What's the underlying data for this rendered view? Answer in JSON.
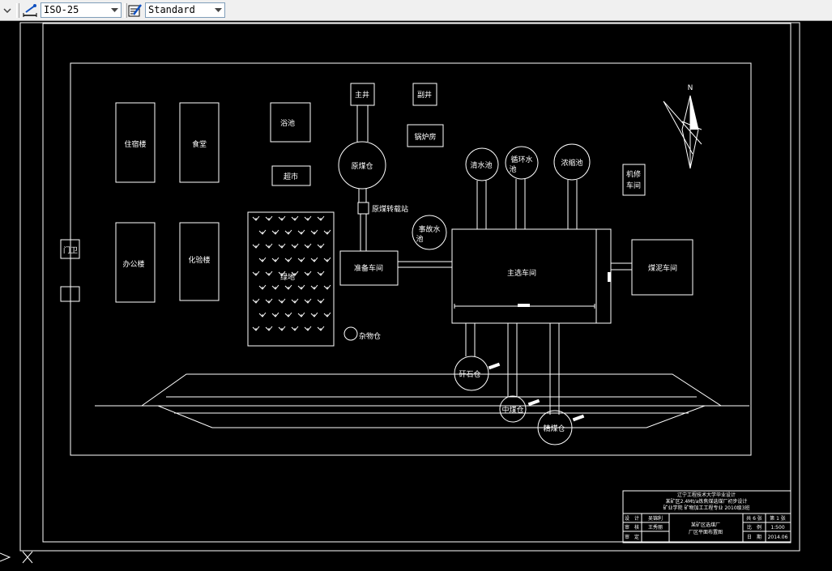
{
  "toolbar": {
    "dimstyle": "ISO-25",
    "textstyle": "Standard"
  },
  "labels": {
    "dorm": "住宿楼",
    "canteen": "食堂",
    "office": "办公楼",
    "lab": "化验楼",
    "gate": "门卫",
    "bath": "浴池",
    "market": "超市",
    "main_shaft": "主井",
    "aux_shaft": "副井",
    "boiler": "锅炉房",
    "raw_silo": "原煤仓",
    "transfer": "原煤转载站",
    "clear_pool": "清水池",
    "circ_pool_1": "循环水",
    "circ_pool_2": "池",
    "thick_pool": "浓缩池",
    "repair_1": "机修",
    "repair_2": "车间",
    "accident_1": "事故水",
    "accident_2": "池",
    "prep": "准备车间",
    "main_plant": "主选车间",
    "slime": "煤泥车间",
    "green": "绿地",
    "misc": "杂物仓",
    "gangue": "矸石仓",
    "middling": "中煤仓",
    "clean": "精煤仓",
    "north": "N"
  },
  "title_block": {
    "line1": "辽宁工程技术大学毕业设计",
    "line2": "某矿区2.4Mt/a炼焦煤选煤厂初步设计",
    "line3": "矿业学院 矿物加工工程专业 2010级3班",
    "design_label": "设　计",
    "design_name": "吴锦利",
    "check_label": "审　核",
    "check_name": "王秀丽",
    "approve_label": "审　定",
    "drawing_1": "某矿区选煤厂",
    "drawing_2": "厂区平面布置图",
    "sheets": "共 6 张",
    "sheet_no": "第 1 张",
    "scale_label": "比　例",
    "scale": "1:500",
    "date_label": "日　期",
    "date": "2014.06"
  }
}
